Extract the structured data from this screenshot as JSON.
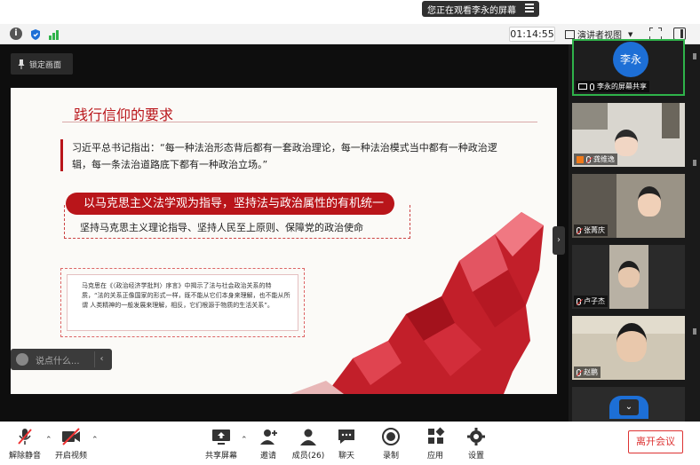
{
  "banner": {
    "text": "您正在观看李永的屏幕"
  },
  "topbar": {
    "timer": "01:14:55",
    "view_label": "演讲者视图"
  },
  "stage": {
    "lock_label": "锁定画面",
    "comment_placeholder": "说点什么...",
    "slide": {
      "title": "践行信仰的要求",
      "quote": "习近平总书记指出：“每一种法治形态背后都有一套政治理论，每一种法治模式当中都有一种政治逻辑，每一条法治道路底下都有一种政治立场。”",
      "red_pill": "以马克思主义法学观为指导，坚持法与政治属性的有机统一",
      "sub_text": "坚持马克思主义理论指导、坚持人民至上原则、保障党的政治使命",
      "note": "马克思在《〈政治经济学批判〉序言》中揭示了法与社会政治关系的特 质，“法的关系正像国家的形式一样，既不能从它们本身来理解，也不能从所谓 人类精神的一般发展来理解，相反，它们根源于物质的生活关系”。"
    }
  },
  "participants": [
    {
      "name": "李永的屏幕共享",
      "avatar_text": "李永",
      "muted": false
    },
    {
      "name": "龚维逸",
      "muted": true
    },
    {
      "name": "张菁庆",
      "muted": true
    },
    {
      "name": "卢子杰",
      "muted": true
    },
    {
      "name": "赵鹏",
      "muted": true
    }
  ],
  "bottombar": {
    "unmute": "解除静音",
    "video": "开启视频",
    "share": "共享屏幕",
    "invite": "邀请",
    "members": "成员(26)",
    "chat": "聊天",
    "record": "录制",
    "apps": "应用",
    "settings": "设置",
    "leave": "离开会议"
  },
  "colors": {
    "accent_red": "#b9151a",
    "blue": "#1d6fd6",
    "green": "#2fb34a"
  }
}
